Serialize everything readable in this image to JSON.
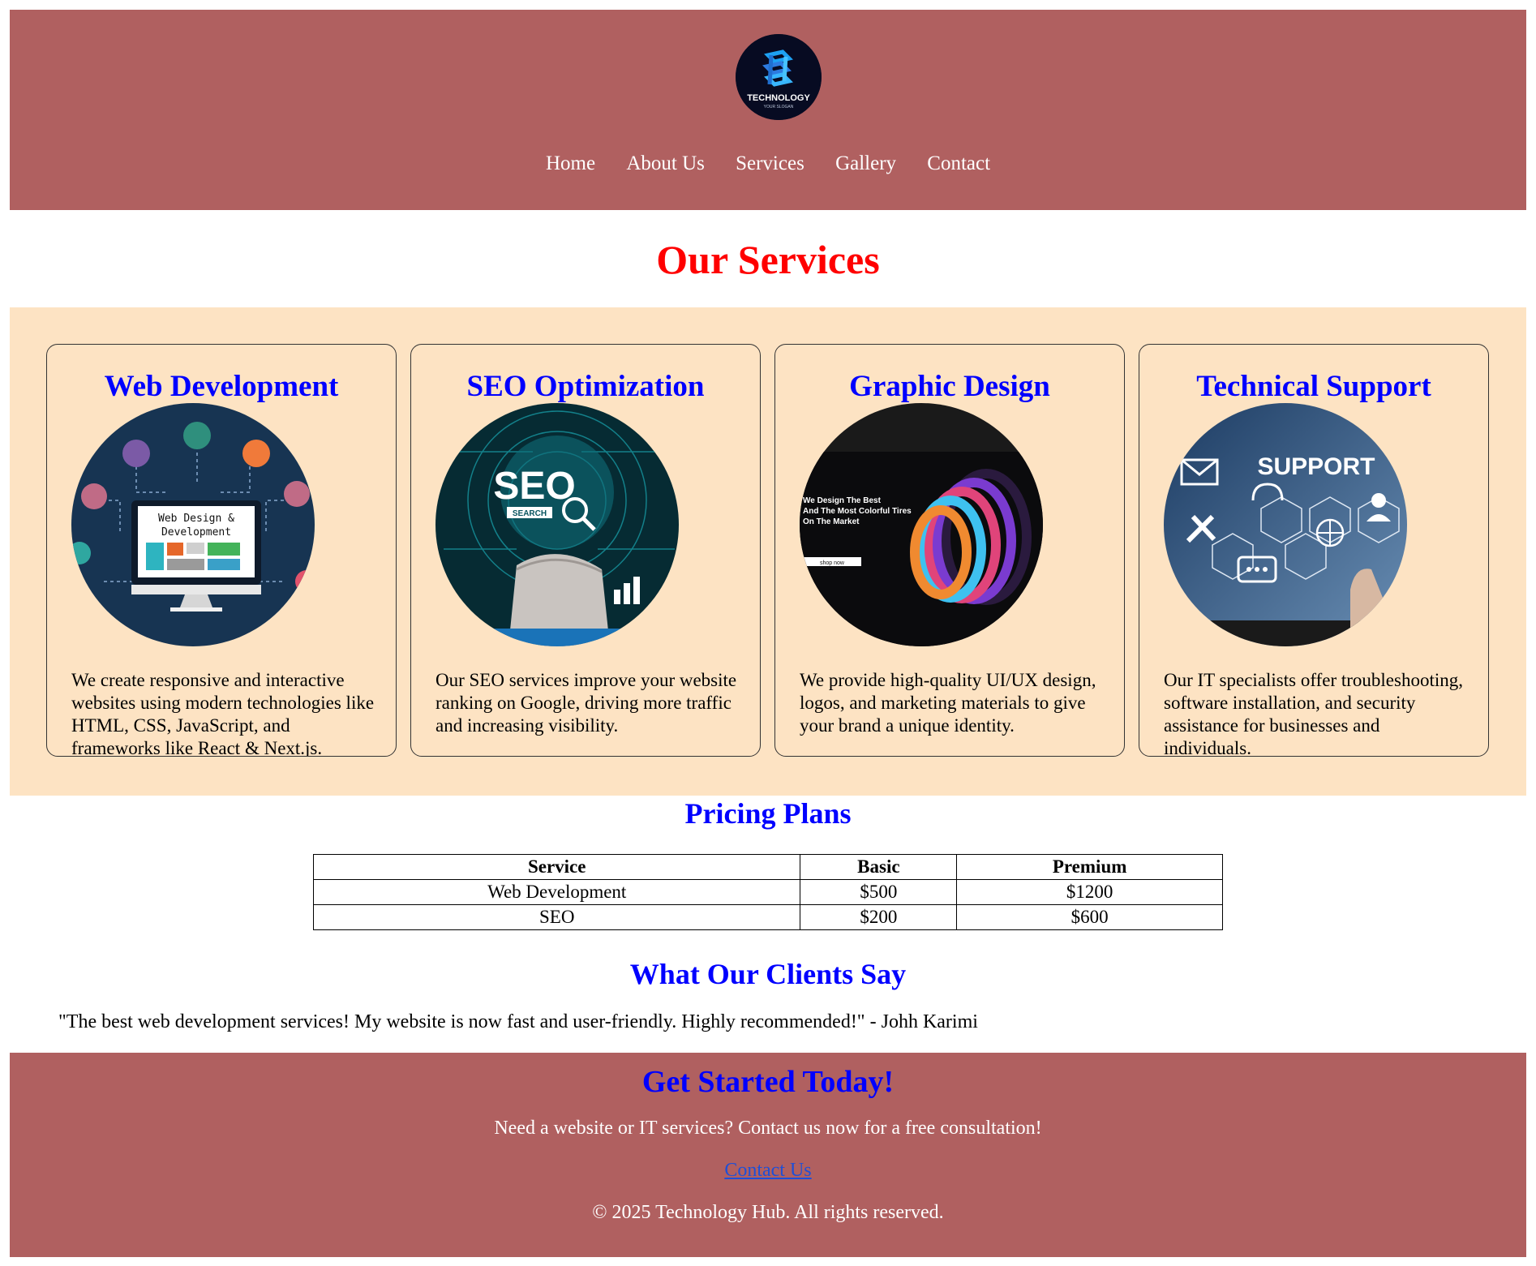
{
  "colors": {
    "header_bg": "#b06060",
    "services_bg": "#fde3c3",
    "main_title": "#ff0000",
    "heading_blue": "#0000ff",
    "link": "#1f4fd6"
  },
  "header": {
    "logo": {
      "icon": "technology-logo-icon",
      "text": "TECHNOLOGY",
      "slogan": "YOUR SLOGAN"
    },
    "nav": [
      "Home",
      "About Us",
      "Services",
      "Gallery",
      "Contact"
    ]
  },
  "page_title": "Our Services",
  "services": [
    {
      "title": "Web Development",
      "image_icon": "web-design-illustration",
      "image_text": [
        "Web Design &",
        "Development"
      ],
      "description": "We create responsive and interactive websites using modern technologies like HTML, CSS, JavaScript, and frameworks like React & Next.js."
    },
    {
      "title": "SEO Optimization",
      "image_icon": "seo-illustration",
      "image_text": [
        "SEO",
        "SEARCH"
      ],
      "description": "Our SEO services improve your website ranking on Google, driving more traffic and increasing visibility."
    },
    {
      "title": "Graphic Design",
      "image_icon": "graphic-design-illustration",
      "image_text": [
        "We Design The Best",
        "And The Most Colorful Tires",
        "On The Market",
        "shop now"
      ],
      "description": "We provide high-quality UI/UX design, logos, and marketing materials to give your brand a unique identity."
    },
    {
      "title": "Technical Support",
      "image_icon": "support-illustration",
      "image_text": [
        "SUPPORT"
      ],
      "description": "Our IT specialists offer troubleshooting, software installation, and security assistance for businesses and individuals."
    }
  ],
  "pricing": {
    "title": "Pricing Plans",
    "headers": [
      "Service",
      "Basic",
      "Premium"
    ],
    "rows": [
      [
        "Web Development",
        "$500",
        "$1200"
      ],
      [
        "SEO",
        "$200",
        "$600"
      ]
    ]
  },
  "testimonials": {
    "title": "What Our Clients Say",
    "quote": "\"The best web development services! My website is now fast and user-friendly. Highly recommended!\" - Johh Karimi"
  },
  "footer": {
    "title": "Get Started Today!",
    "cta": "Need a website or IT services? Contact us now for a free consultation!",
    "link": "Contact Us",
    "copyright": "© 2025 Technology Hub. All rights reserved."
  }
}
